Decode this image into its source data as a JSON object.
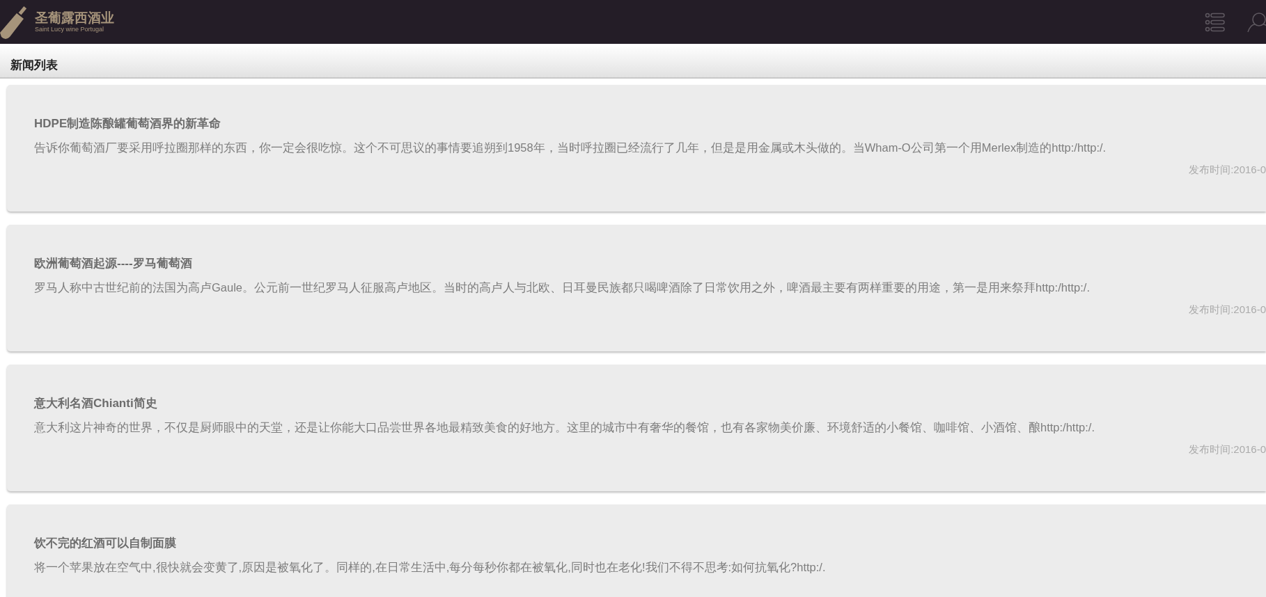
{
  "header": {
    "brand_name": "圣葡露西酒业",
    "brand_tagline": "Saint Lucy wine Portugal"
  },
  "section_title": "新闻列表",
  "news": [
    {
      "title": "HDPE制造陈酿罐葡萄酒界的新革命",
      "summary": "告诉你葡萄酒厂要采用呼拉圈那样的东西，你一定会很吃惊。这个不可思议的事情要追朔到1958年，当时呼拉圈已经流行了几年，但是是用金属或木头做的。当Wham-O公司第一个用Merlex制造的http:/http:/.",
      "date": "发布时间:2016-0"
    },
    {
      "title": "欧洲葡萄酒起源----罗马葡萄酒",
      "summary": "罗马人称中古世纪前的法国为高卢Gaule。公元前一世纪罗马人征服高卢地区。当时的高卢人与北欧、日耳曼民族都只喝啤酒除了日常饮用之外，啤酒最主要有两样重要的用途，第一是用来祭拜http:/http:/.",
      "date": "发布时间:2016-0"
    },
    {
      "title": "意大利名酒Chianti简史",
      "summary": "意大利这片神奇的世界，不仅是厨师眼中的天堂，还是让你能大口品尝世界各地最精致美食的好地方。这里的城市中有奢华的餐馆，也有各家物美价廉、环境舒适的小餐馆、咖啡馆、小酒馆、酿http:/http:/.",
      "date": "发布时间:2016-0"
    },
    {
      "title": "饮不完的红酒可以自制面膜",
      "summary": "将一个苹果放在空气中,很快就会变黄了,原因是被氧化了。同样的,在日常生活中,每分每秒你都在被氧化,同时也在老化!我们不得不思考:如何抗氧化?http:/."
    }
  ]
}
